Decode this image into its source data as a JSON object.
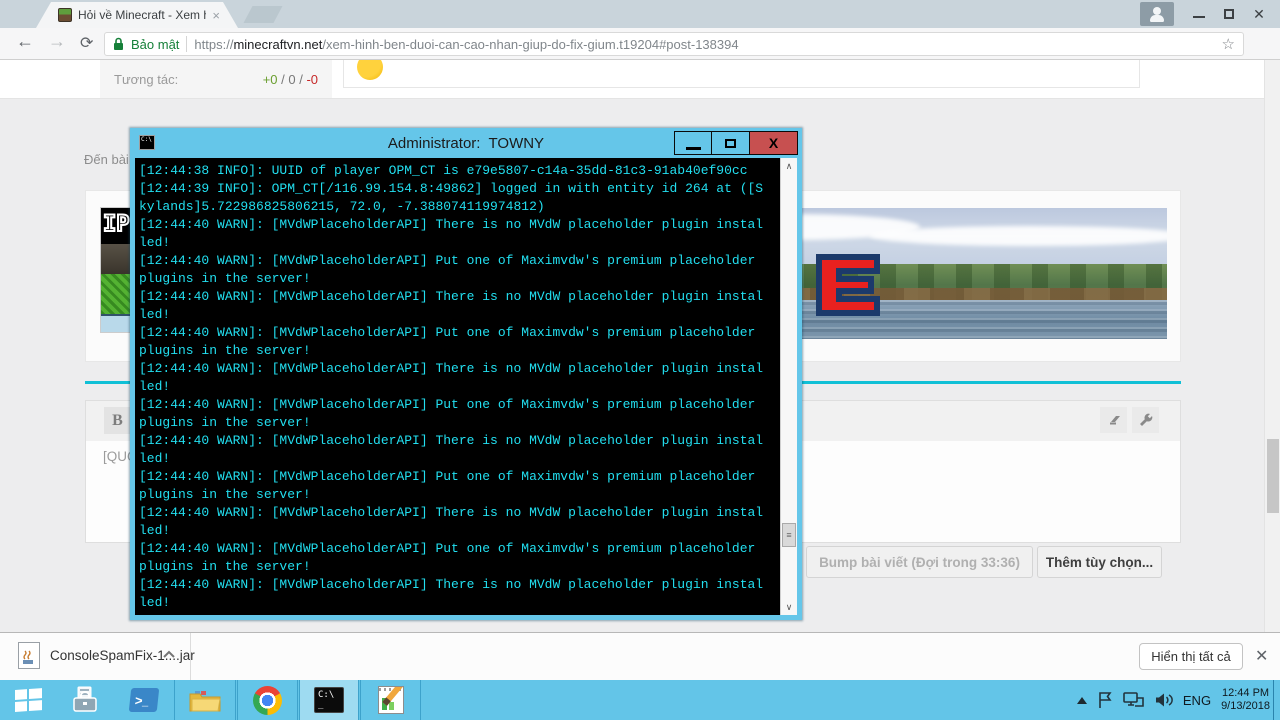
{
  "browser": {
    "tab_title": "Hỏi về Minecraft - Xem h",
    "tab_close_glyph": "×",
    "nav": {
      "back_glyph": "←",
      "forward_glyph": "→",
      "refresh_glyph": "⟳"
    },
    "security_label": "Bảo mật",
    "url_scheme": "https://",
    "url_domain": "minecraftvn.net",
    "url_path": "/xem-hinh-ben-duoi-can-cao-nhan-giup-do-fix-gium.t19204#post-138394",
    "star_glyph": "☆",
    "menu_glyph": "⋮",
    "close_glyph": "✕"
  },
  "page": {
    "interaction_label": "Tương tác:",
    "interaction_pos": "+0",
    "interaction_mid": " / 0 / ",
    "interaction_neg": "-0",
    "goto_post_label": "Đến bài",
    "ip_image_label": "IP",
    "banner_letter": "E",
    "bold_button_label": "B",
    "editor_text": "[QUOTE",
    "bump_button_label": "Bump bài viết (Đợi trong 33:36)",
    "more_options_label": "Thêm tùy chọn...",
    "accent_cyan": "#10c0d6"
  },
  "console": {
    "title": "Administrator:  TOWNY",
    "icon_label": "C:\\",
    "close_glyph": "X",
    "text_color": "#22dff0",
    "titlebar_color": "#65c6e9",
    "close_red": "#c75050",
    "scroll_up_glyph": "∧",
    "scroll_down_glyph": "∨",
    "thumb_grip_glyph": "≡",
    "lines": [
      "[12:44:38 INFO]: UUID of player OPM_CT is e79e5807-c14a-35dd-81c3-91ab40ef90cc",
      "[12:44:39 INFO]: OPM_CT[/116.99.154.8:49862] logged in with entity id 264 at ([S",
      "kylands]5.722986825806215, 72.0, -7.388074119974812)",
      "[12:44:40 WARN]: [MVdWPlaceholderAPI] There is no MVdW placeholder plugin instal",
      "led!",
      "[12:44:40 WARN]: [MVdWPlaceholderAPI] Put one of Maximvdw's premium placeholder ",
      "plugins in the server!",
      "[12:44:40 WARN]: [MVdWPlaceholderAPI] There is no MVdW placeholder plugin instal",
      "led!",
      "[12:44:40 WARN]: [MVdWPlaceholderAPI] Put one of Maximvdw's premium placeholder ",
      "plugins in the server!",
      "[12:44:40 WARN]: [MVdWPlaceholderAPI] There is no MVdW placeholder plugin instal",
      "led!",
      "[12:44:40 WARN]: [MVdWPlaceholderAPI] Put one of Maximvdw's premium placeholder ",
      "plugins in the server!",
      "[12:44:40 WARN]: [MVdWPlaceholderAPI] There is no MVdW placeholder plugin instal",
      "led!",
      "[12:44:40 WARN]: [MVdWPlaceholderAPI] Put one of Maximvdw's premium placeholder ",
      "plugins in the server!",
      "[12:44:40 WARN]: [MVdWPlaceholderAPI] There is no MVdW placeholder plugin instal",
      "led!",
      "[12:44:40 WARN]: [MVdWPlaceholderAPI] Put one of Maximvdw's premium placeholder ",
      "plugins in the server!",
      "[12:44:40 WARN]: [MVdWPlaceholderAPI] There is no MVdW placeholder plugin instal",
      "led!"
    ]
  },
  "download_bar": {
    "filename": "ConsoleSpamFix-1....jar",
    "show_all_label": "Hiển thị tất cả",
    "close_glyph": "✕"
  },
  "taskbar": {
    "cmd_icon_label": "C:\\ _",
    "powershell_glyph": ">",
    "language": "ENG",
    "time": "12:44 PM",
    "date": "9/13/2018",
    "blue": "#63c5e8"
  }
}
